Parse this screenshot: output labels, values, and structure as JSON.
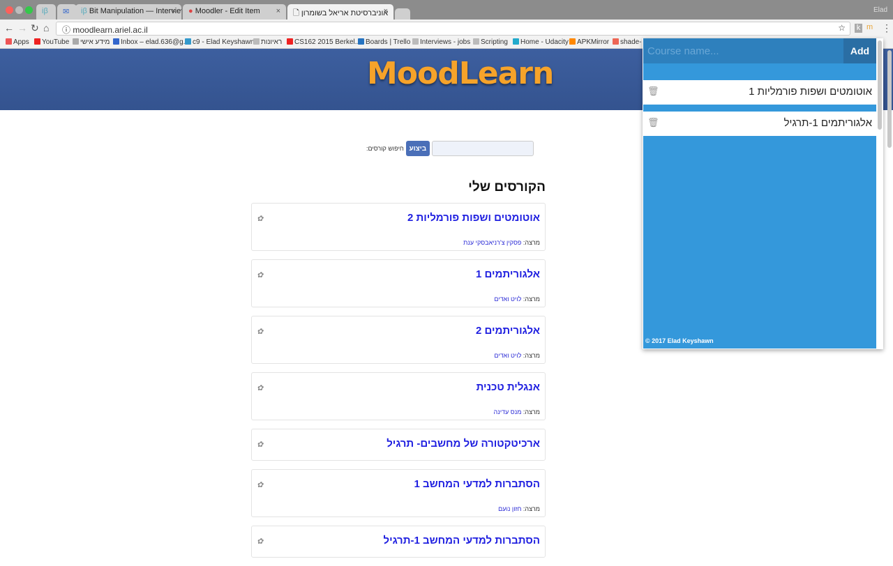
{
  "browser": {
    "tabs": [
      {
        "label": ""
      },
      {
        "label": ""
      },
      {
        "label": "Bit Manipulation — InterviewBit"
      },
      {
        "label": "Moodler - Edit Item"
      },
      {
        "label": "אוניברסיטת אריאל בשומרון"
      }
    ],
    "profile": "Elad",
    "url": "moodlearn.ariel.ac.il",
    "bookmarks": [
      "Apps",
      "YouTube",
      "מידע אישי",
      "Inbox – elad.636@g...",
      "c9 - Elad Keyshawn",
      "ראיונות",
      "CS162 2015 Berkel...",
      "Boards | Trello",
      "Interviews - jobs",
      "Scripting",
      "Home - Udacity",
      "APKMirror",
      "shade-"
    ]
  },
  "site": {
    "logo": "MoodLearn",
    "search_label": "חיפוש קורסים:",
    "search_button": "ביצוע",
    "heading": "הקורסים שלי",
    "teacher_label": "מרצה:",
    "courses": [
      {
        "name": "אוטומטים ושפות פורמליות 2",
        "teacher": "פסקין צ'רניאבסקי ענת"
      },
      {
        "name": "אלגוריתמים 1",
        "teacher": "לויט ואדים"
      },
      {
        "name": "אלגוריתמים 2",
        "teacher": "לויט ואדים"
      },
      {
        "name": "אנגלית טכנית",
        "teacher": "מנס עדינה"
      },
      {
        "name": "ארכיטקטורה של מחשבים- תרגיל",
        "teacher": null
      },
      {
        "name": "הסתברות למדעי המחשב 1",
        "teacher": "חזון נועם"
      },
      {
        "name": "הסתברות למדעי המחשב 1-תרגיל",
        "teacher": null
      }
    ]
  },
  "popup": {
    "input_placeholder": "Course name...",
    "add_button": "Add",
    "items": [
      "אוטומטים ושפות פורמליות 1",
      "אלגוריתמים 1-תרגיל"
    ],
    "footer": "© 2017 Elad Keyshawn",
    "colors": {
      "background": "#3498db",
      "input_row": "#2e80bd",
      "add_button": "#2a6ea4"
    }
  }
}
